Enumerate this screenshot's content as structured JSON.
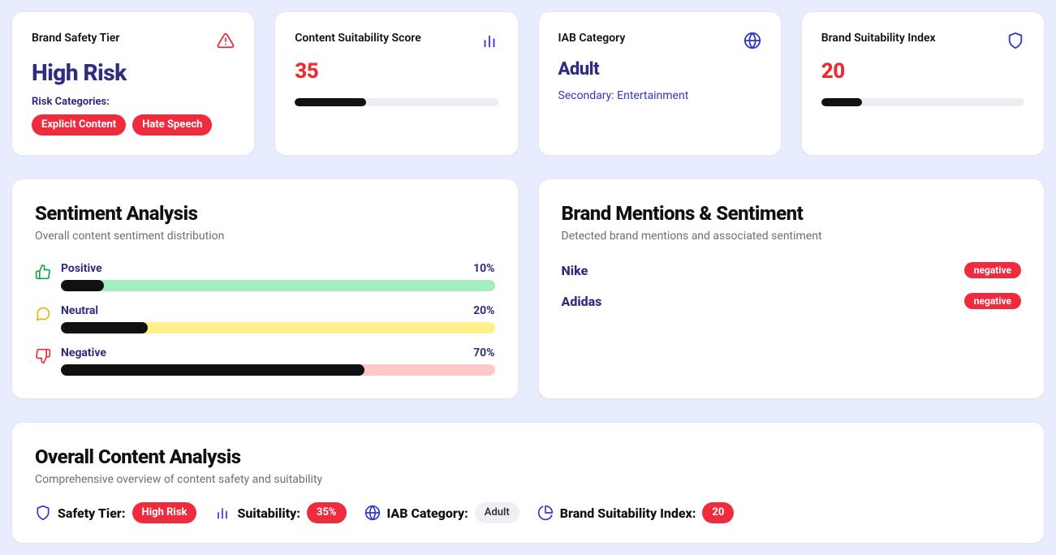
{
  "colors": {
    "accent_red": "#ef2b3e",
    "accent_purple": "#2f2c82",
    "accent_blue": "#3437c7"
  },
  "topCards": {
    "safety": {
      "title": "Brand Safety Tier",
      "value": "High Risk",
      "risk_label": "Risk Categories:",
      "chips": [
        "Explicit Content",
        "Hate Speech"
      ]
    },
    "suitability": {
      "title": "Content Suitability Score",
      "value": "35",
      "percent": 35
    },
    "iab": {
      "title": "IAB Category",
      "value": "Adult",
      "secondary": "Secondary: Entertainment"
    },
    "bsi": {
      "title": "Brand Suitability Index",
      "value": "20",
      "percent": 20
    }
  },
  "sentiment": {
    "title": "Sentiment Analysis",
    "subtitle": "Overall content sentiment distribution",
    "items": [
      {
        "label": "Positive",
        "pct_label": "10%",
        "pct": 10
      },
      {
        "label": "Neutral",
        "pct_label": "20%",
        "pct": 20
      },
      {
        "label": "Negative",
        "pct_label": "70%",
        "pct": 70
      }
    ]
  },
  "mentions": {
    "title": "Brand Mentions & Sentiment",
    "subtitle": "Detected brand mentions and associated sentiment",
    "items": [
      {
        "name": "Nike",
        "sentiment": "negative"
      },
      {
        "name": "Adidas",
        "sentiment": "negative"
      }
    ]
  },
  "overall": {
    "title": "Overall Content Analysis",
    "subtitle": "Comprehensive overview of content safety and suitability",
    "items": {
      "safety": {
        "label": "Safety Tier:",
        "badge": "High Risk"
      },
      "suit": {
        "label": "Suitability:",
        "badge": "35%"
      },
      "iab": {
        "label": "IAB Category:",
        "badge": "Adult"
      },
      "bsi": {
        "label": "Brand Suitability Index:",
        "badge": "20"
      }
    }
  }
}
